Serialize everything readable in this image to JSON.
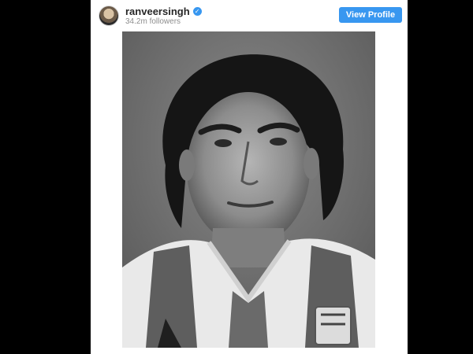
{
  "post": {
    "username": "ranveersingh",
    "followers": "34.2m followers",
    "view_profile_label": "View Profile"
  },
  "icons": {
    "verified": "verified-badge-icon"
  }
}
